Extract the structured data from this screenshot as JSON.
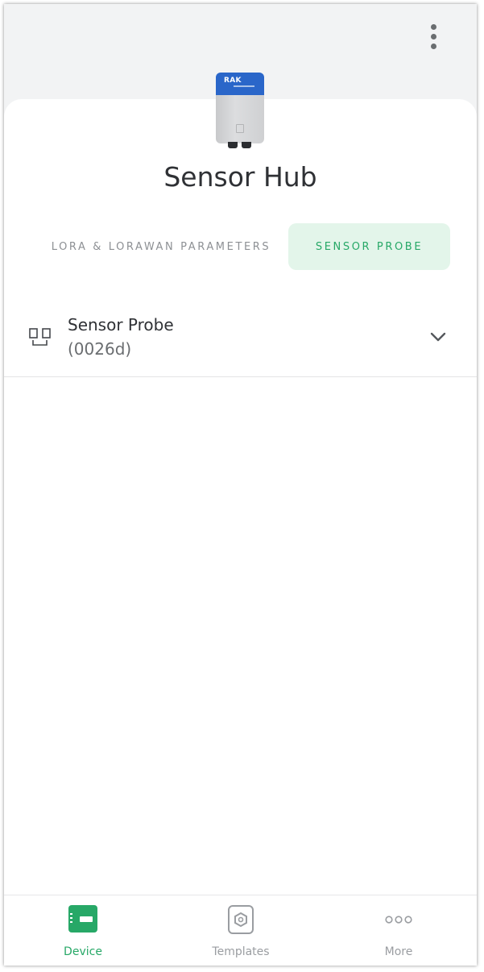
{
  "header": {
    "menu_icon": "more-vertical-icon"
  },
  "device": {
    "image_icon": "rak-sensor-hub-device",
    "logo_text": "RAK",
    "title": "Sensor Hub"
  },
  "tabs": [
    {
      "label": "LORA & LORAWAN PARAMETERS",
      "active": false
    },
    {
      "label": "SENSOR PROBE",
      "active": true
    }
  ],
  "probe": {
    "icon": "sensor-probe-icon",
    "name": "Sensor Probe",
    "code": "(0026d)",
    "expand_icon": "chevron-down-icon"
  },
  "bottom_nav": [
    {
      "label": "Device",
      "icon": "device-icon",
      "active": true
    },
    {
      "label": "Templates",
      "icon": "templates-icon",
      "active": false
    },
    {
      "label": "More",
      "icon": "more-horizontal-icon",
      "active": false
    }
  ],
  "colors": {
    "accent": "#27a867",
    "accent_bg": "#e3f5ea",
    "header_bg": "#f2f3f4",
    "text_primary": "#2f3135",
    "text_muted": "#8d9094"
  }
}
